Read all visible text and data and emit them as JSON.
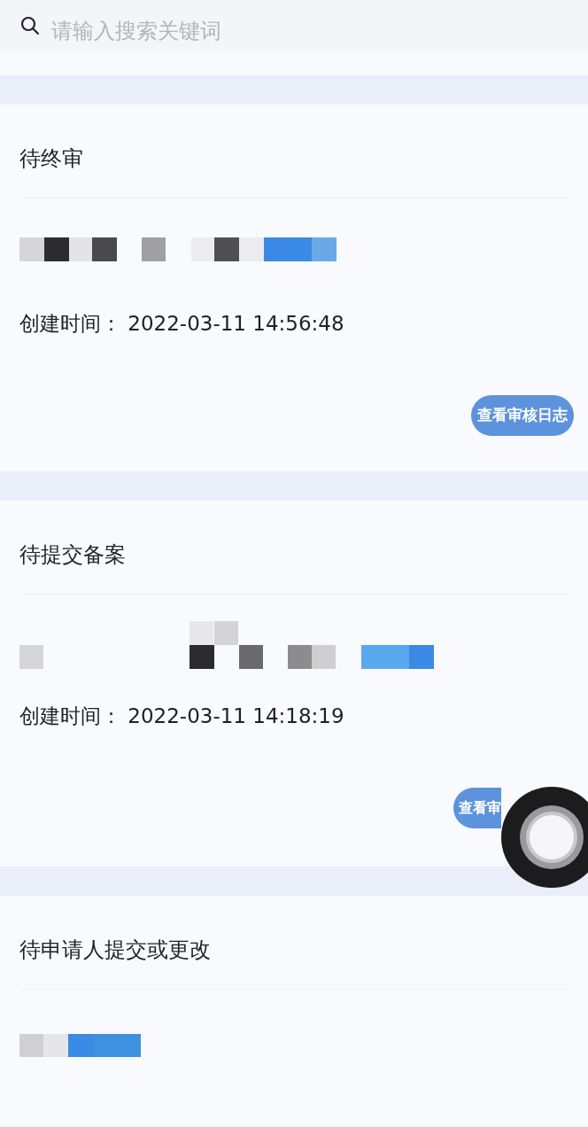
{
  "search": {
    "placeholder": "请输入搜索关键词"
  },
  "records": [
    {
      "status": "待终审",
      "created_label": "创建时间：",
      "created_time": "2022-03-11 14:56:48",
      "button": "查看审核日志",
      "button_covered": false
    },
    {
      "status": "待提交备案",
      "created_label": "创建时间：",
      "created_time": "2022-03-11 14:18:19",
      "button": "查看审",
      "button_covered": true
    },
    {
      "status": "待申请人提交或更改"
    }
  ]
}
